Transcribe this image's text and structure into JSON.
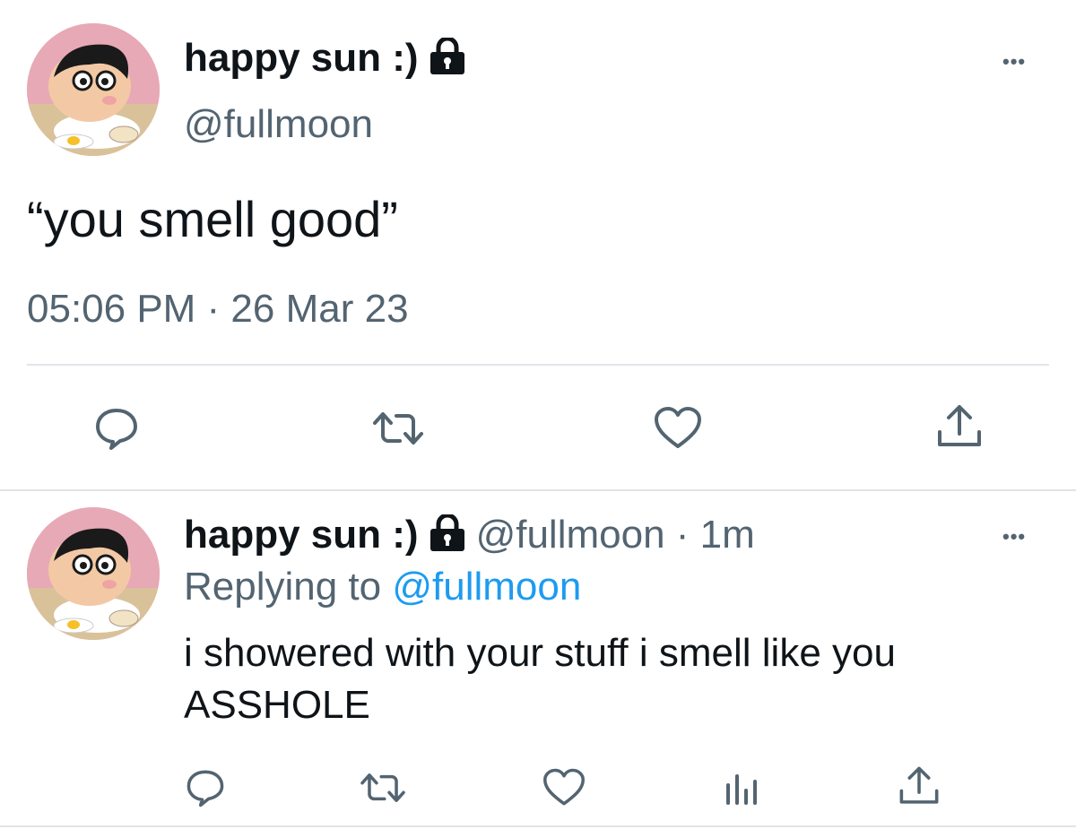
{
  "main_tweet": {
    "display_name": "happy sun :)",
    "handle": "@fullmoon",
    "text": "“you smell good”",
    "timestamp": "05:06 PM · 26 Mar 23",
    "lock_icon": "lock-icon",
    "more_icon": "more-icon",
    "more_label": "•••",
    "actions": [
      "reply-icon",
      "retweet-icon",
      "like-icon",
      "share-icon"
    ]
  },
  "reply_tweet": {
    "display_name": "happy sun :)",
    "handle": "@fullmoon",
    "separator": " · ",
    "time_ago": "1m",
    "replying_prefix": "Replying to ",
    "replying_handle": "@fullmoon",
    "text_line1": "i showered with your stuff i smell like you",
    "text_line2": "ASSHOLE",
    "lock_icon": "lock-icon",
    "more_label": "•••",
    "actions": [
      "reply-icon",
      "retweet-icon",
      "like-icon",
      "analytics-icon",
      "share-icon"
    ]
  },
  "colors": {
    "text": "#0f1419",
    "muted": "#536471",
    "link": "#1d9bf0",
    "divider": "#e1e5e9"
  }
}
